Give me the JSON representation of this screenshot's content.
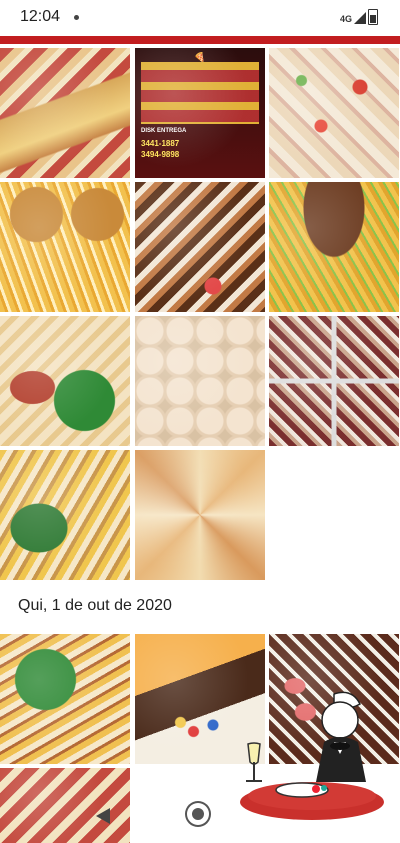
{
  "status_bar": {
    "time": "12:04",
    "network": "4G"
  },
  "feed": {
    "date_label": "Qui, 1 de out de 2020"
  },
  "flyer": {
    "delivery_label": "DISK ENTREGA",
    "phone_1": "3441-1887",
    "phone_2": "3494-9898"
  },
  "colors": {
    "accent": "#c21d20",
    "background": "#ffffff"
  },
  "icons": [
    "back-icon",
    "home-icon",
    "restaurant-logo"
  ]
}
